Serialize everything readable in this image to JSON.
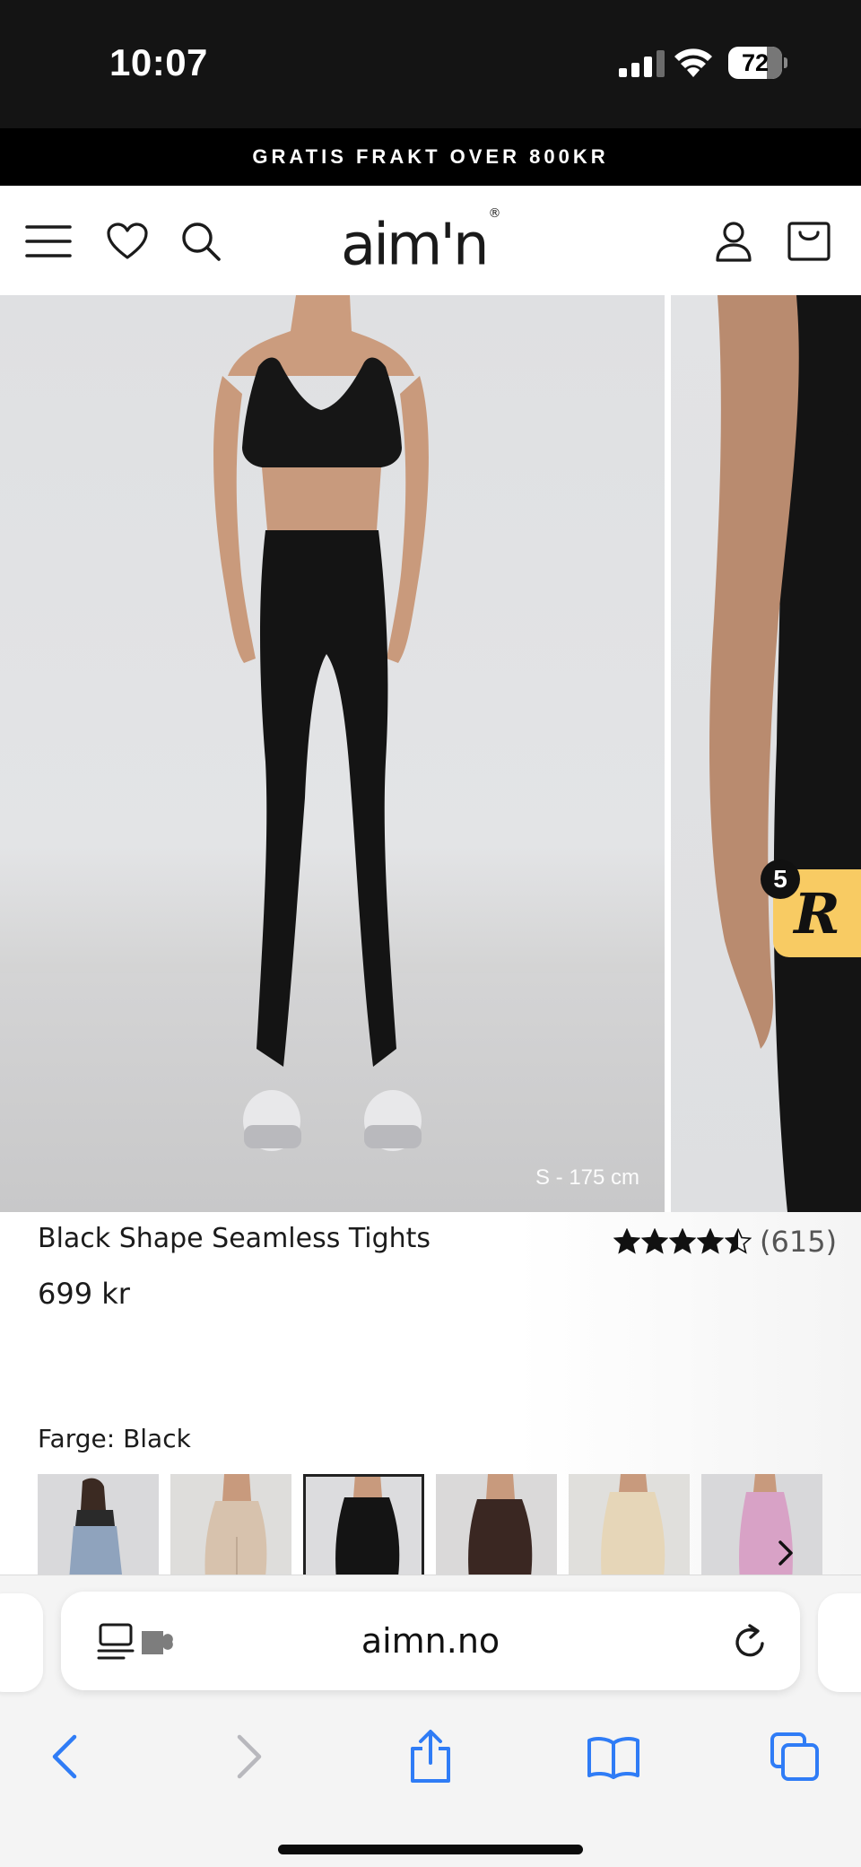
{
  "status_bar": {
    "time": "10:07",
    "battery_level": "72",
    "battery_fraction": 0.72
  },
  "announcement": {
    "text": "GRATIS FRAKT OVER 800KR"
  },
  "header": {
    "logo": "aim'n",
    "logo_mark": "®",
    "icons": [
      "menu-icon",
      "heart-icon",
      "search-icon",
      "account-icon",
      "cart-icon"
    ]
  },
  "gallery": {
    "caption": "S - 175 cm",
    "review_badge": {
      "count": "5",
      "letter": "R",
      "color": "#f8cb63"
    }
  },
  "product": {
    "title": "Black Shape Seamless Tights",
    "price": "699 kr",
    "rating": {
      "stars": 4.5,
      "max": 5,
      "count_label": "(615)"
    },
    "color": {
      "label": "Farge:",
      "value": "Black",
      "swatches": [
        {
          "name": "light-blue",
          "selected": false
        },
        {
          "name": "beige",
          "selected": false
        },
        {
          "name": "black",
          "selected": true
        },
        {
          "name": "dark-brown",
          "selected": false
        },
        {
          "name": "cream",
          "selected": false
        },
        {
          "name": "pink",
          "selected": false
        }
      ]
    }
  },
  "browser": {
    "url": "aimn.no",
    "accent": "#2f7cf6",
    "toolbar": [
      "back-icon",
      "forward-icon",
      "share-icon",
      "bookmarks-icon",
      "tabs-icon"
    ]
  }
}
